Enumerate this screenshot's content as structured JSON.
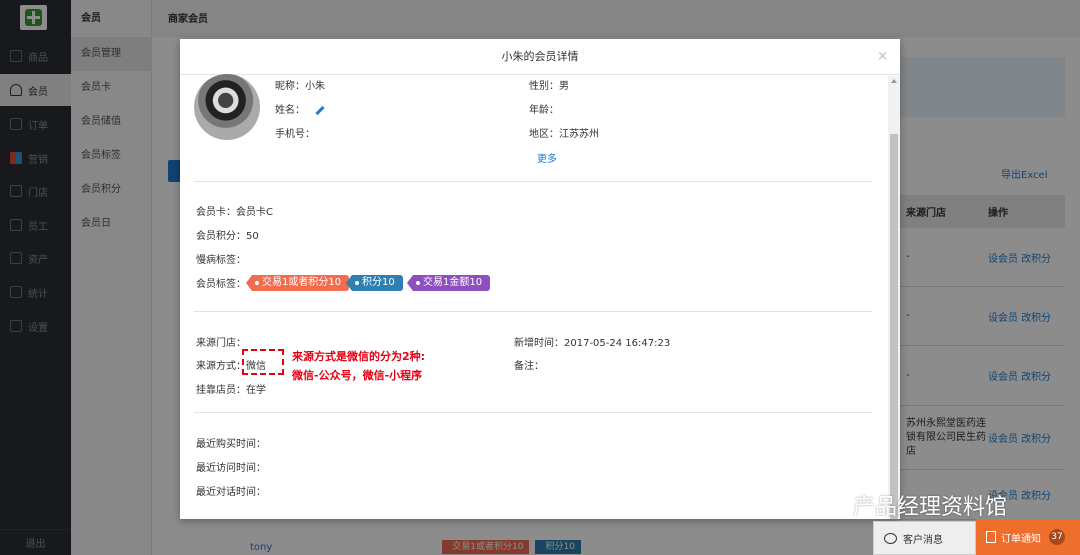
{
  "nav": {
    "items": [
      {
        "label": "商品",
        "icon": "product-icon"
      },
      {
        "label": "会员",
        "icon": "member-icon",
        "active": true
      },
      {
        "label": "订单",
        "icon": "order-icon"
      },
      {
        "label": "营销",
        "icon": "marketing-icon"
      },
      {
        "label": "门店",
        "icon": "store-icon"
      },
      {
        "label": "员工",
        "icon": "staff-icon"
      },
      {
        "label": "资产",
        "icon": "asset-icon"
      },
      {
        "label": "统计",
        "icon": "stats-icon"
      },
      {
        "label": "设置",
        "icon": "settings-icon"
      }
    ],
    "logout": "退出"
  },
  "submenu": {
    "title": "会员",
    "items": [
      "会员管理",
      "会员卡",
      "会员储值",
      "会员标签",
      "会员积分",
      "会员日"
    ]
  },
  "main": {
    "title": "商家会员",
    "export": "导出Excel",
    "table": {
      "headers": [
        "来源门店",
        "操作"
      ],
      "rows": [
        {
          "source": "-",
          "ops": "设会员 改积分"
        },
        {
          "source": "-",
          "ops": "设会员 改积分"
        },
        {
          "source": "-",
          "ops": "设会员 改积分"
        },
        {
          "source": "苏州永熙堂医药连锁有限公司民生药店",
          "ops": "设会员 改积分"
        },
        {
          "source": "",
          "ops": "设会员 改积分"
        }
      ]
    },
    "bottom_name": "tony",
    "bottom_tags": [
      "交易1或者积分10",
      "积分10"
    ]
  },
  "modal": {
    "title": "小朱的会员详情",
    "close": "×",
    "nickname": "昵称：小朱",
    "gender": "性别：男",
    "name": "姓名：",
    "age": "年龄：",
    "phone": "手机号：",
    "region": "地区：江苏苏州",
    "more": "更多",
    "card": "会员卡：会员卡C",
    "points": "会员积分：50",
    "disease_tags": "慢病标签：",
    "member_tags_label": "会员标签：",
    "tags": [
      {
        "text": "交易1或者积分10",
        "color": "#f26c4f"
      },
      {
        "text": "积分10",
        "color": "#2f7fb0"
      },
      {
        "text": "交易1金额10",
        "color": "#8e4fbf"
      }
    ],
    "source_store": "来源门店：",
    "source_method_label": "来源方式：",
    "source_method_value": "微信",
    "assigned_staff": "挂靠店员：在学",
    "added_time": "新增时间：2017-05-24 16:47:23",
    "remark": "备注：",
    "last_purchase": "最近购买时间：",
    "last_visit": "最近访问时间：",
    "last_chat": "最近对话时间：",
    "annotation_line1": "来源方式是微信的分为2种:",
    "annotation_line2": "微信-公众号，微信-小程序"
  },
  "footer": {
    "messages": "客户消息",
    "orders": "订单通知",
    "order_count": "37"
  },
  "watermark": "产品经理资料馆"
}
